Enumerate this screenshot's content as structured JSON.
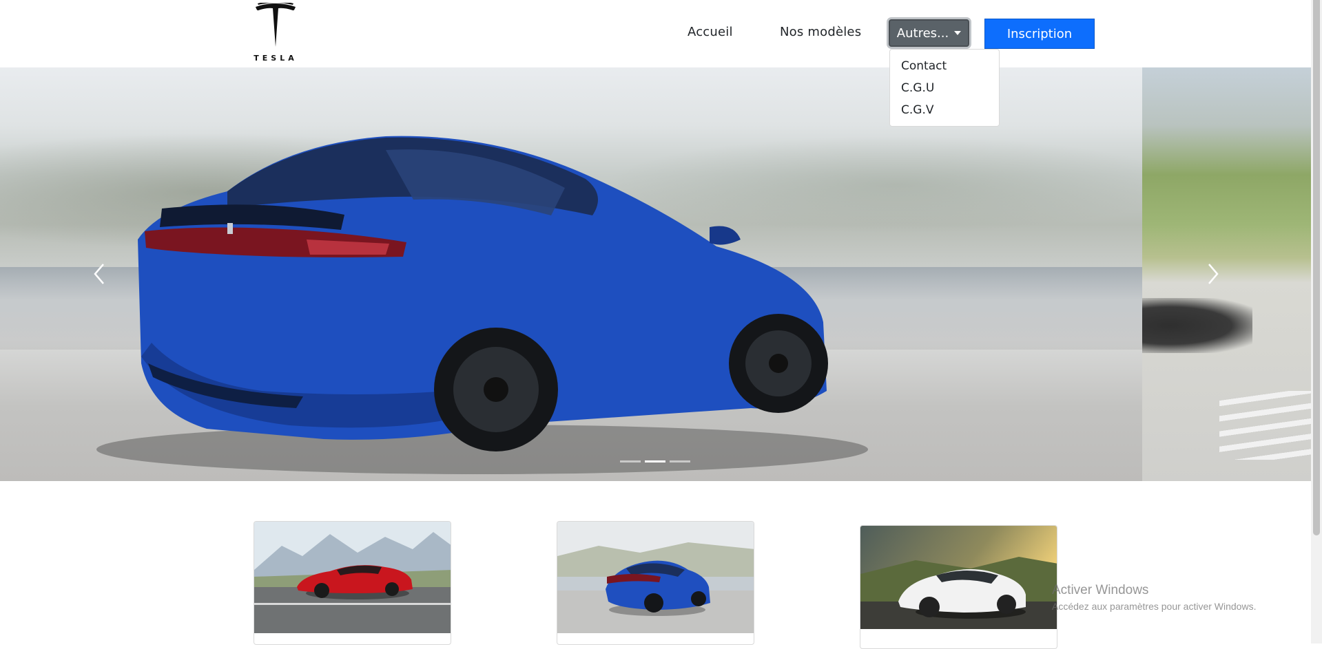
{
  "brand": {
    "logo_text": "TESLA",
    "logo_alt": "tesla-logo"
  },
  "nav": {
    "home_label": "Accueil",
    "models_label": "Nos modèles",
    "dropdown_label": "Autres...",
    "signup_label": "Inscription",
    "dropdown_items": [
      {
        "label": "Contact"
      },
      {
        "label": "C.G.U"
      },
      {
        "label": "C.G.V"
      }
    ],
    "dropdown_open": true
  },
  "carousel": {
    "slides": [
      {
        "image": "blue-model-y-rear-view"
      },
      {
        "image": "blue-model-y-rear-view"
      },
      {
        "image": "road-landscape"
      }
    ],
    "active_index": 1
  },
  "cards": [
    {
      "image": "red-model-s"
    },
    {
      "image": "blue-model-y"
    },
    {
      "image": "white-model-x"
    }
  ],
  "watermark": {
    "title": "Activer Windows",
    "subtitle": "Accédez aux paramètres pour activer Windows."
  },
  "colors": {
    "primary": "#0d6efd",
    "secondary": "#5a6268",
    "car_blue": "#1f4fb8"
  }
}
